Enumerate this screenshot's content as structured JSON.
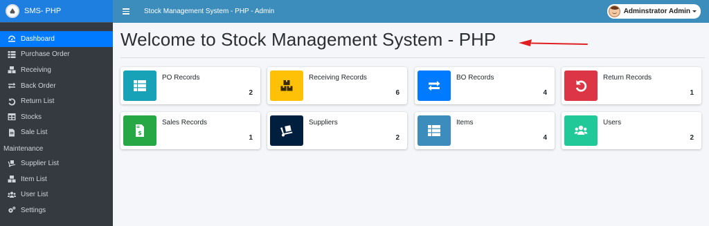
{
  "brand": {
    "name": "SMS- PHP"
  },
  "topbar": {
    "title": "Stock Management System - PHP - Admin",
    "user_name": "Adminstrator Admin"
  },
  "sidebar": {
    "items": [
      {
        "label": "Dashboard",
        "icon": "dashboard-icon",
        "active": true
      },
      {
        "label": "Purchase Order",
        "icon": "table-list-icon"
      },
      {
        "label": "Receiving",
        "icon": "boxes-icon"
      },
      {
        "label": "Back Order",
        "icon": "exchange-icon"
      },
      {
        "label": "Return List",
        "icon": "undo-icon"
      },
      {
        "label": "Stocks",
        "icon": "table-icon"
      },
      {
        "label": "Sale List",
        "icon": "file-invoice-icon"
      }
    ],
    "maintenance_header": "Maintenance",
    "maintenance_items": [
      {
        "label": "Supplier List",
        "icon": "dolly-icon"
      },
      {
        "label": "Item List",
        "icon": "boxes-icon"
      },
      {
        "label": "User List",
        "icon": "users-icon"
      },
      {
        "label": "Settings",
        "icon": "cogs-icon"
      }
    ]
  },
  "main": {
    "title": "Welcome to Stock Management System - PHP",
    "cards": [
      {
        "label": "PO Records",
        "count": "2",
        "color": "#17a2b8",
        "icon": "th-list-icon"
      },
      {
        "label": "Receiving Records",
        "count": "6",
        "color": "#ffc107",
        "icon": "boxes-icon"
      },
      {
        "label": "BO Records",
        "count": "4",
        "color": "#007bff",
        "icon": "exchange-icon"
      },
      {
        "label": "Return Records",
        "count": "1",
        "color": "#dc3545",
        "icon": "undo-icon"
      },
      {
        "label": "Sales Records",
        "count": "1",
        "color": "#28a745",
        "icon": "file-invoice-dollar-icon"
      },
      {
        "label": "Suppliers",
        "count": "2",
        "color": "#001f3f",
        "icon": "dolly-icon"
      },
      {
        "label": "Items",
        "count": "4",
        "color": "#3c8dbc",
        "icon": "th-list-icon"
      },
      {
        "label": "Users",
        "count": "2",
        "color": "#20c997",
        "icon": "users-icon"
      }
    ]
  },
  "colors": {
    "sidebar_bg": "#343a40",
    "brand_bg": "#1e7fe0",
    "topbar_bg": "#3c8dbc",
    "active_nav": "#007bff",
    "annotation_arrow": "#e02020"
  }
}
